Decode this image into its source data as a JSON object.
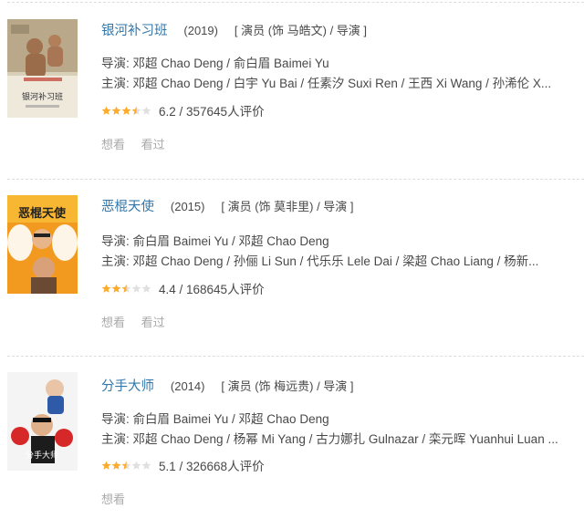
{
  "colors": {
    "link": "#3377aa",
    "text": "#494949",
    "muted": "#aaaaaa",
    "star_on": "#ffac2d",
    "star_off": "#e0e0e0",
    "divider": "#dddddd"
  },
  "entries": [
    {
      "title": "银河补习班",
      "year": "(2019)",
      "roles": "[ 演员 (饰 马皓文) / 导演 ]",
      "director_line": "导演: 邓超 Chao Deng / 俞白眉 Baimei Yu",
      "cast_line": "主演: 邓超 Chao Deng / 白宇 Yu Bai / 任素汐 Suxi Ren / 王西 Xi Wang / 孙浠伦 X...",
      "score": "6.2 / 357645人评价",
      "stars": 3.5,
      "action_want": "想看",
      "action_seen": "看过",
      "poster_icon": "poster-father-and-son"
    },
    {
      "title": "恶棍天使",
      "year": "(2015)",
      "roles": "[ 演员 (饰 莫非里) / 导演 ]",
      "director_line": "导演: 俞白眉 Baimei Yu / 邓超 Chao Deng",
      "cast_line": "主演: 邓超 Chao Deng / 孙俪 Li Sun / 代乐乐 Lele Dai / 梁超 Chao Liang / 杨新...",
      "score": "4.4 / 168645人评价",
      "stars": 2.5,
      "action_want": "想看",
      "action_seen": "看过",
      "poster_icon": "poster-angel-wings"
    },
    {
      "title": "分手大师",
      "year": "(2014)",
      "roles": "[ 演员 (饰 梅远贵) / 导演 ]",
      "director_line": "导演: 俞白眉 Baimei Yu / 邓超 Chao Deng",
      "cast_line": "主演: 邓超 Chao Deng / 杨幂 Mi Yang / 古力娜扎 Gulnazar / 栾元晖 Yuanhui Luan ...",
      "score": "5.1 / 326668人评价",
      "stars": 2.5,
      "action_want": "想看",
      "poster_icon": "poster-boxing-man"
    }
  ]
}
